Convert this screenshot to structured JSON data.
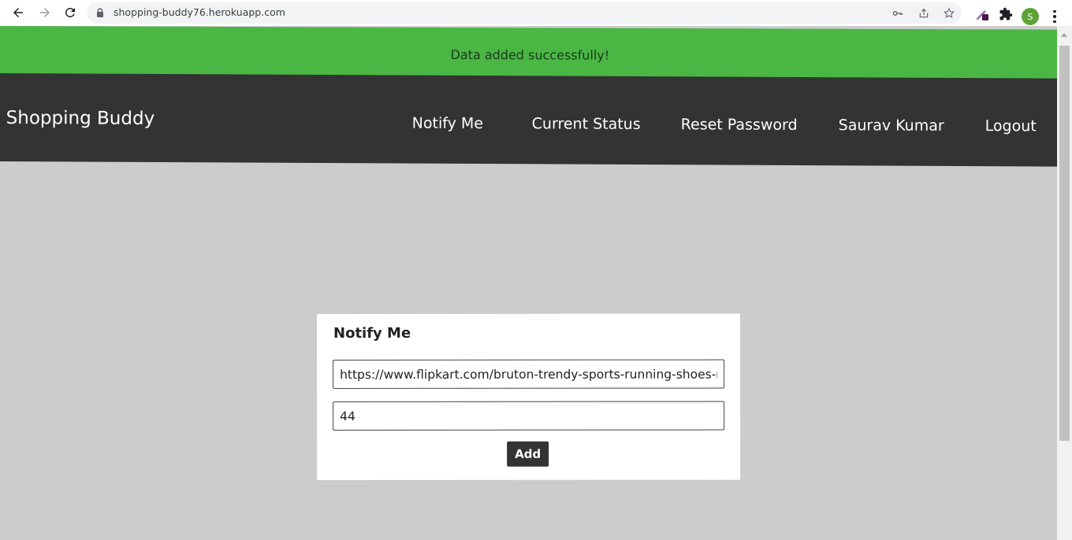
{
  "browser": {
    "url": "shopping-buddy76.herokuapp.com",
    "profile_initial": "S",
    "icons": [
      "back-icon",
      "forward-icon",
      "reload-icon",
      "lock-icon",
      "key-icon",
      "share-icon",
      "star-icon",
      "extension-pen-icon",
      "puzzle-icon",
      "kebab-menu-icon"
    ]
  },
  "alert": {
    "message": "Data added successfully!"
  },
  "navbar": {
    "brand": "Shopping Buddy",
    "links": [
      {
        "label": "Notify Me"
      },
      {
        "label": "Current Status"
      },
      {
        "label": "Reset Password"
      },
      {
        "label": "Saurav Kumar"
      },
      {
        "label": "Logout"
      }
    ]
  },
  "form": {
    "title": "Notify Me",
    "url_value": "https://www.flipkart.com/bruton-trendy-sports-running-shoes-men",
    "price_value": "44",
    "submit_label": "Add"
  },
  "colors": {
    "alert_green": "#4ab744",
    "navbar_bg": "#333333",
    "page_bg": "#cccccc",
    "button_bg": "#333333"
  }
}
